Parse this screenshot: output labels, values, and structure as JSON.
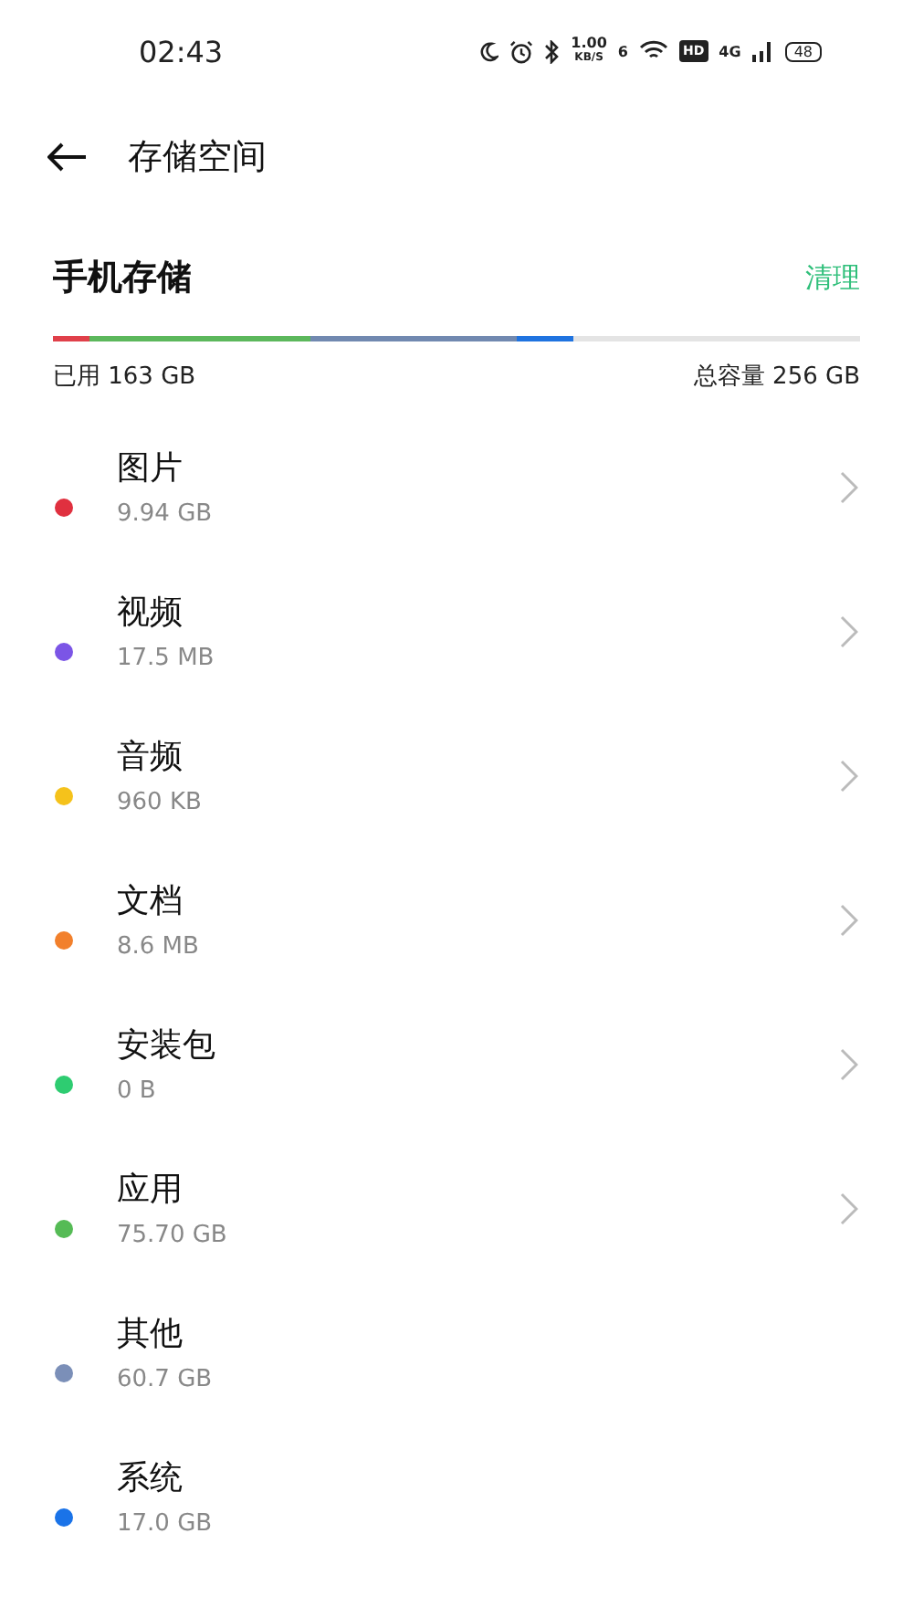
{
  "status_bar": {
    "time": "02:43",
    "speed": "1.00",
    "speed_unit": "KB/S",
    "wifi_generation": "6",
    "hd": "HD",
    "network": "4G",
    "battery": "48"
  },
  "header": {
    "title": "存储空间"
  },
  "storage": {
    "title": "手机存储",
    "action": "清理",
    "used": "已用 163 GB",
    "total": "总容量 256 GB",
    "segments": [
      {
        "color": "#e0404a"
      },
      {
        "color": "#5cb85c"
      },
      {
        "color": "#7189b0"
      },
      {
        "color": "#1f73e0"
      }
    ]
  },
  "categories": [
    {
      "name": "图片",
      "size": "9.94 GB",
      "color": "#e0303f",
      "chevron": true
    },
    {
      "name": "视频",
      "size": "17.5 MB",
      "color": "#7b55e6",
      "chevron": true
    },
    {
      "name": "音频",
      "size": "960 KB",
      "color": "#f5c21b",
      "chevron": true
    },
    {
      "name": "文档",
      "size": "8.6 MB",
      "color": "#f2802c",
      "chevron": true
    },
    {
      "name": "安装包",
      "size": "0 B",
      "color": "#2ecc71",
      "chevron": true
    },
    {
      "name": "应用",
      "size": "75.70  GB",
      "color": "#55bb55",
      "chevron": true
    },
    {
      "name": "其他",
      "size": "60.7 GB",
      "color": "#7b8fb8",
      "chevron": false
    },
    {
      "name": "系统",
      "size": "17.0 GB",
      "color": "#1a73e8",
      "chevron": false
    }
  ]
}
